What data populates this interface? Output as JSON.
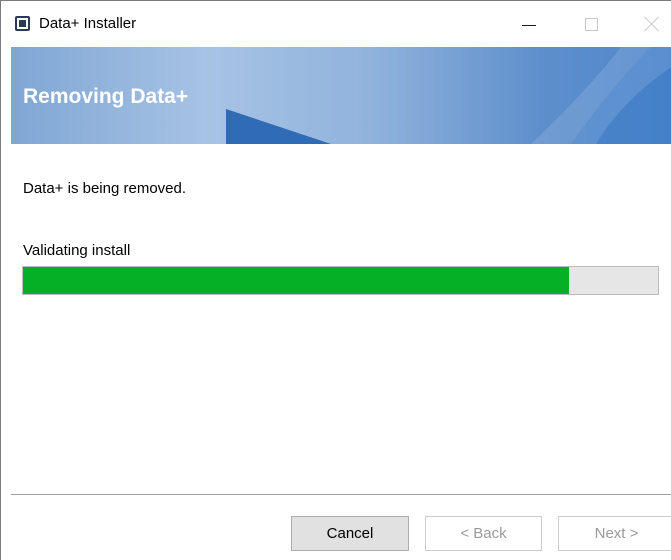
{
  "window": {
    "title": "Data+ Installer"
  },
  "banner": {
    "title": "Removing Data+"
  },
  "content": {
    "status": "Data+ is being removed.",
    "step": "Validating install",
    "progress_percent": 86
  },
  "footer": {
    "cancel_label": "Cancel",
    "back_label": "< Back",
    "next_label": "Next >"
  },
  "colors": {
    "progress_fill": "#06b025",
    "banner_accent": "#2f6bb7"
  },
  "icons": {
    "app": "app-window-icon",
    "minimize": "minimize-icon",
    "maximize": "maximize-icon",
    "close": "close-icon"
  }
}
